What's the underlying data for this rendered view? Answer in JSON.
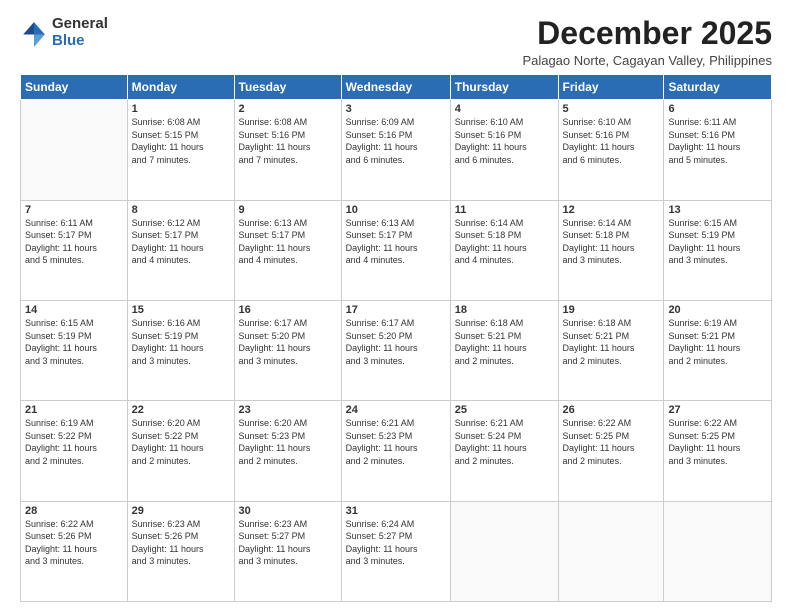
{
  "logo": {
    "general": "General",
    "blue": "Blue"
  },
  "title": "December 2025",
  "subtitle": "Palagao Norte, Cagayan Valley, Philippines",
  "days_header": [
    "Sunday",
    "Monday",
    "Tuesday",
    "Wednesday",
    "Thursday",
    "Friday",
    "Saturday"
  ],
  "weeks": [
    [
      {
        "day": "",
        "info": ""
      },
      {
        "day": "1",
        "info": "Sunrise: 6:08 AM\nSunset: 5:15 PM\nDaylight: 11 hours\nand 7 minutes."
      },
      {
        "day": "2",
        "info": "Sunrise: 6:08 AM\nSunset: 5:16 PM\nDaylight: 11 hours\nand 7 minutes."
      },
      {
        "day": "3",
        "info": "Sunrise: 6:09 AM\nSunset: 5:16 PM\nDaylight: 11 hours\nand 6 minutes."
      },
      {
        "day": "4",
        "info": "Sunrise: 6:10 AM\nSunset: 5:16 PM\nDaylight: 11 hours\nand 6 minutes."
      },
      {
        "day": "5",
        "info": "Sunrise: 6:10 AM\nSunset: 5:16 PM\nDaylight: 11 hours\nand 6 minutes."
      },
      {
        "day": "6",
        "info": "Sunrise: 6:11 AM\nSunset: 5:16 PM\nDaylight: 11 hours\nand 5 minutes."
      }
    ],
    [
      {
        "day": "7",
        "info": "Sunrise: 6:11 AM\nSunset: 5:17 PM\nDaylight: 11 hours\nand 5 minutes."
      },
      {
        "day": "8",
        "info": "Sunrise: 6:12 AM\nSunset: 5:17 PM\nDaylight: 11 hours\nand 4 minutes."
      },
      {
        "day": "9",
        "info": "Sunrise: 6:13 AM\nSunset: 5:17 PM\nDaylight: 11 hours\nand 4 minutes."
      },
      {
        "day": "10",
        "info": "Sunrise: 6:13 AM\nSunset: 5:17 PM\nDaylight: 11 hours\nand 4 minutes."
      },
      {
        "day": "11",
        "info": "Sunrise: 6:14 AM\nSunset: 5:18 PM\nDaylight: 11 hours\nand 4 minutes."
      },
      {
        "day": "12",
        "info": "Sunrise: 6:14 AM\nSunset: 5:18 PM\nDaylight: 11 hours\nand 3 minutes."
      },
      {
        "day": "13",
        "info": "Sunrise: 6:15 AM\nSunset: 5:19 PM\nDaylight: 11 hours\nand 3 minutes."
      }
    ],
    [
      {
        "day": "14",
        "info": "Sunrise: 6:15 AM\nSunset: 5:19 PM\nDaylight: 11 hours\nand 3 minutes."
      },
      {
        "day": "15",
        "info": "Sunrise: 6:16 AM\nSunset: 5:19 PM\nDaylight: 11 hours\nand 3 minutes."
      },
      {
        "day": "16",
        "info": "Sunrise: 6:17 AM\nSunset: 5:20 PM\nDaylight: 11 hours\nand 3 minutes."
      },
      {
        "day": "17",
        "info": "Sunrise: 6:17 AM\nSunset: 5:20 PM\nDaylight: 11 hours\nand 3 minutes."
      },
      {
        "day": "18",
        "info": "Sunrise: 6:18 AM\nSunset: 5:21 PM\nDaylight: 11 hours\nand 2 minutes."
      },
      {
        "day": "19",
        "info": "Sunrise: 6:18 AM\nSunset: 5:21 PM\nDaylight: 11 hours\nand 2 minutes."
      },
      {
        "day": "20",
        "info": "Sunrise: 6:19 AM\nSunset: 5:21 PM\nDaylight: 11 hours\nand 2 minutes."
      }
    ],
    [
      {
        "day": "21",
        "info": "Sunrise: 6:19 AM\nSunset: 5:22 PM\nDaylight: 11 hours\nand 2 minutes."
      },
      {
        "day": "22",
        "info": "Sunrise: 6:20 AM\nSunset: 5:22 PM\nDaylight: 11 hours\nand 2 minutes."
      },
      {
        "day": "23",
        "info": "Sunrise: 6:20 AM\nSunset: 5:23 PM\nDaylight: 11 hours\nand 2 minutes."
      },
      {
        "day": "24",
        "info": "Sunrise: 6:21 AM\nSunset: 5:23 PM\nDaylight: 11 hours\nand 2 minutes."
      },
      {
        "day": "25",
        "info": "Sunrise: 6:21 AM\nSunset: 5:24 PM\nDaylight: 11 hours\nand 2 minutes."
      },
      {
        "day": "26",
        "info": "Sunrise: 6:22 AM\nSunset: 5:25 PM\nDaylight: 11 hours\nand 2 minutes."
      },
      {
        "day": "27",
        "info": "Sunrise: 6:22 AM\nSunset: 5:25 PM\nDaylight: 11 hours\nand 3 minutes."
      }
    ],
    [
      {
        "day": "28",
        "info": "Sunrise: 6:22 AM\nSunset: 5:26 PM\nDaylight: 11 hours\nand 3 minutes."
      },
      {
        "day": "29",
        "info": "Sunrise: 6:23 AM\nSunset: 5:26 PM\nDaylight: 11 hours\nand 3 minutes."
      },
      {
        "day": "30",
        "info": "Sunrise: 6:23 AM\nSunset: 5:27 PM\nDaylight: 11 hours\nand 3 minutes."
      },
      {
        "day": "31",
        "info": "Sunrise: 6:24 AM\nSunset: 5:27 PM\nDaylight: 11 hours\nand 3 minutes."
      },
      {
        "day": "",
        "info": ""
      },
      {
        "day": "",
        "info": ""
      },
      {
        "day": "",
        "info": ""
      }
    ]
  ]
}
